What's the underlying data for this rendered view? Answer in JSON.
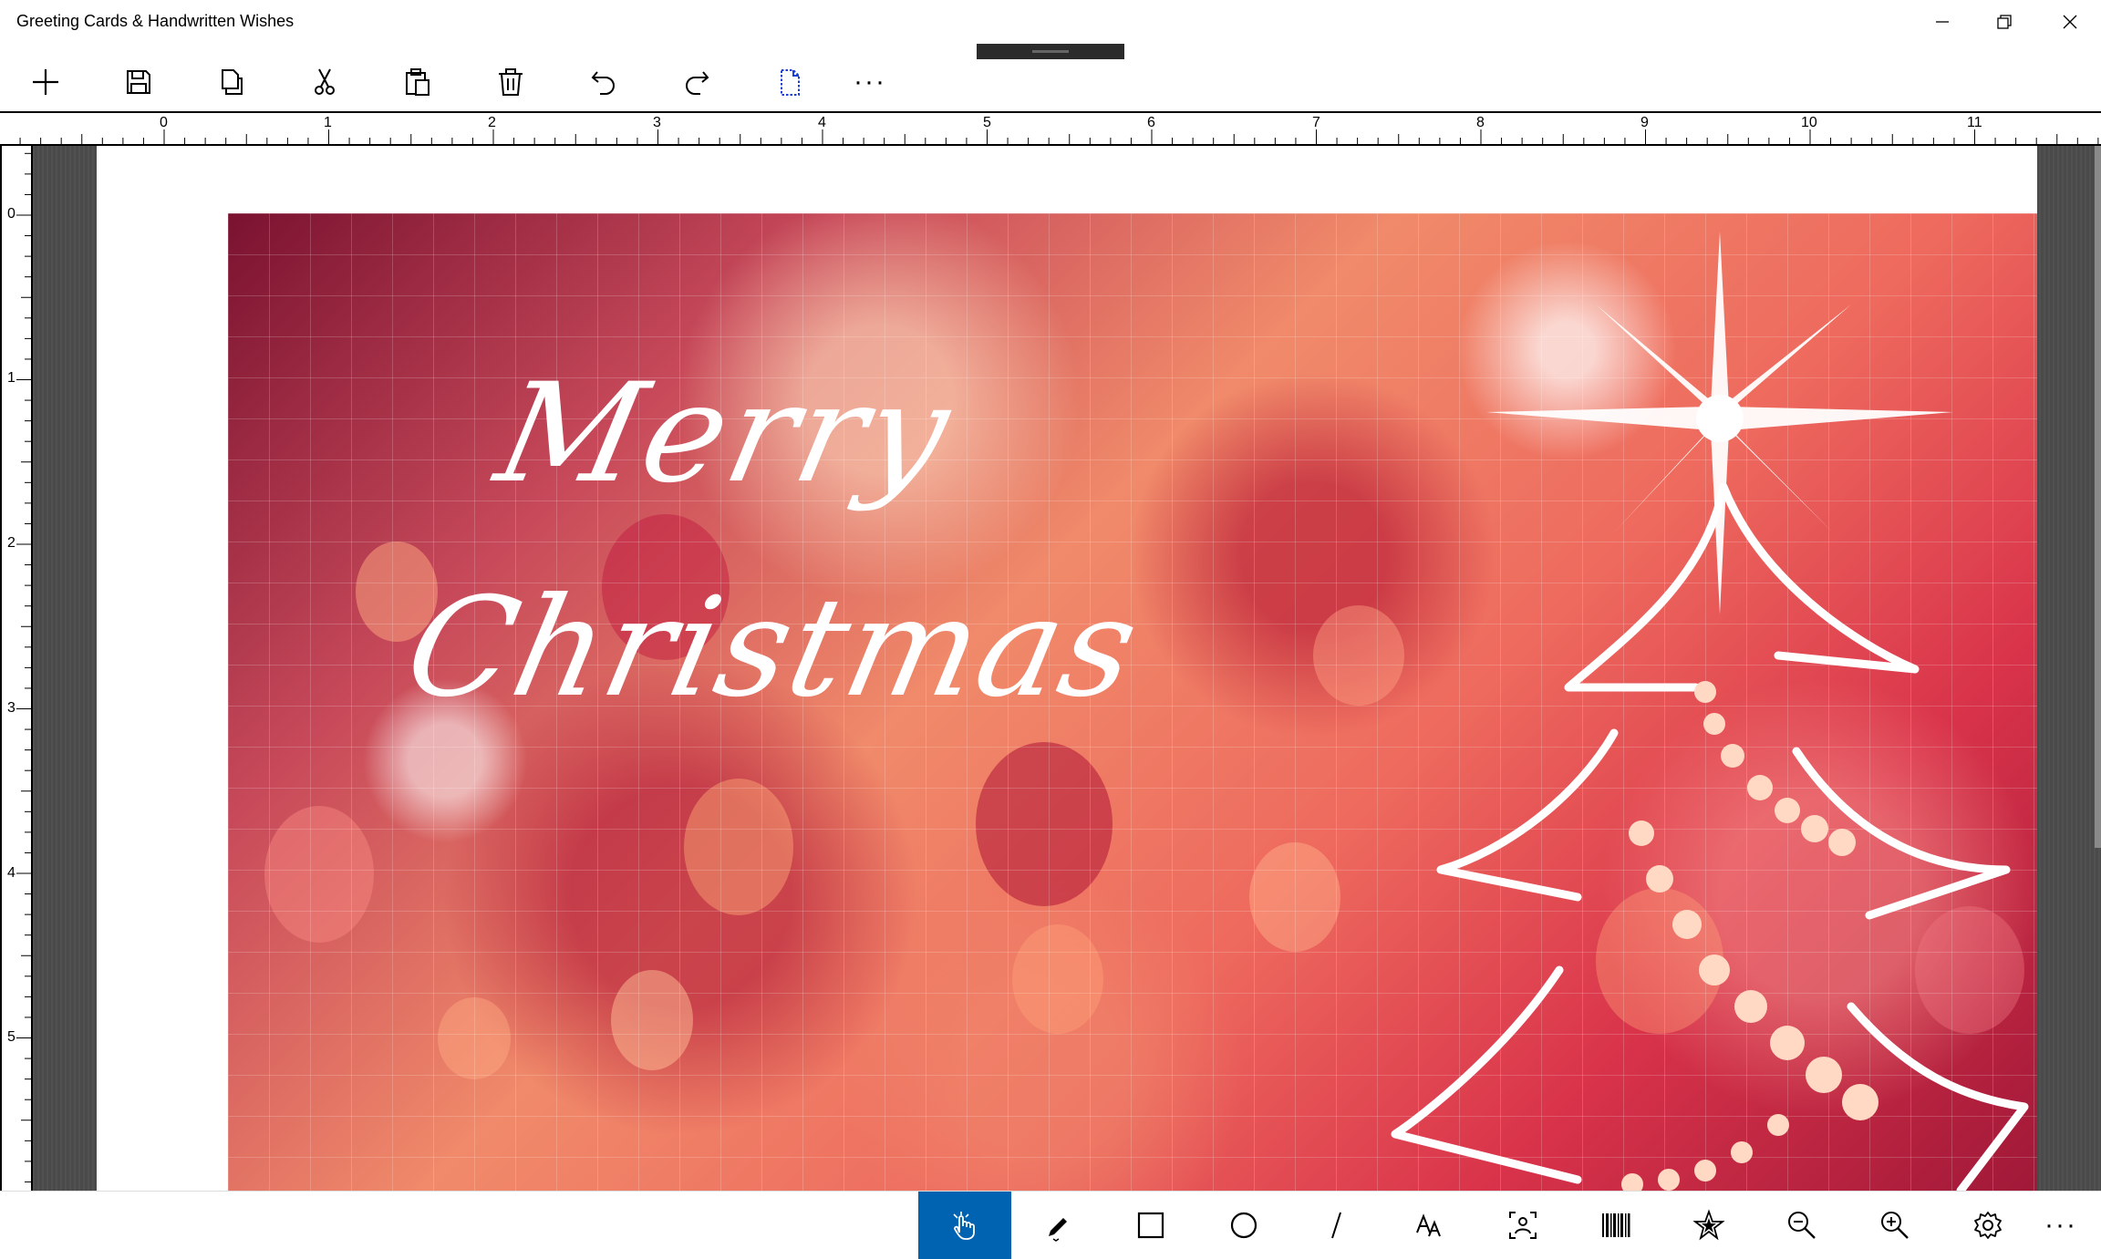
{
  "window": {
    "title": "Greeting Cards & Handwritten Wishes",
    "minimize_icon": "minimize-icon",
    "restore_icon": "restore-icon",
    "close_icon": "close-icon"
  },
  "toolbar": {
    "items": [
      "add-icon",
      "save-icon",
      "copy-icon",
      "cut-icon",
      "paste-icon",
      "delete-icon",
      "undo-icon",
      "redo-icon",
      "page-select-icon",
      "more-icon"
    ],
    "more_label": "···"
  },
  "ruler": {
    "horizontal_labels": [
      "0",
      "1",
      "2",
      "3",
      "4",
      "5",
      "6",
      "7",
      "8",
      "9",
      "10",
      "11"
    ],
    "vertical_labels": [
      "0",
      "1",
      "2",
      "3",
      "4",
      "5"
    ]
  },
  "card": {
    "line1": "Merry",
    "line2": "Christmas"
  },
  "bottom_toolbar": {
    "items": [
      "pointer-hand-icon",
      "pen-icon",
      "rectangle-icon",
      "ellipse-icon",
      "line-icon",
      "text-icon",
      "image-frame-icon",
      "barcode-icon",
      "star-shape-icon",
      "zoom-out-icon",
      "zoom-in-icon",
      "settings-icon",
      "more-icon"
    ],
    "active": "pointer-hand-icon",
    "more_label": "···"
  },
  "colors": {
    "accent": "#0063b1",
    "workspace": "#4a4a4a",
    "card_base": "#e8685c"
  }
}
